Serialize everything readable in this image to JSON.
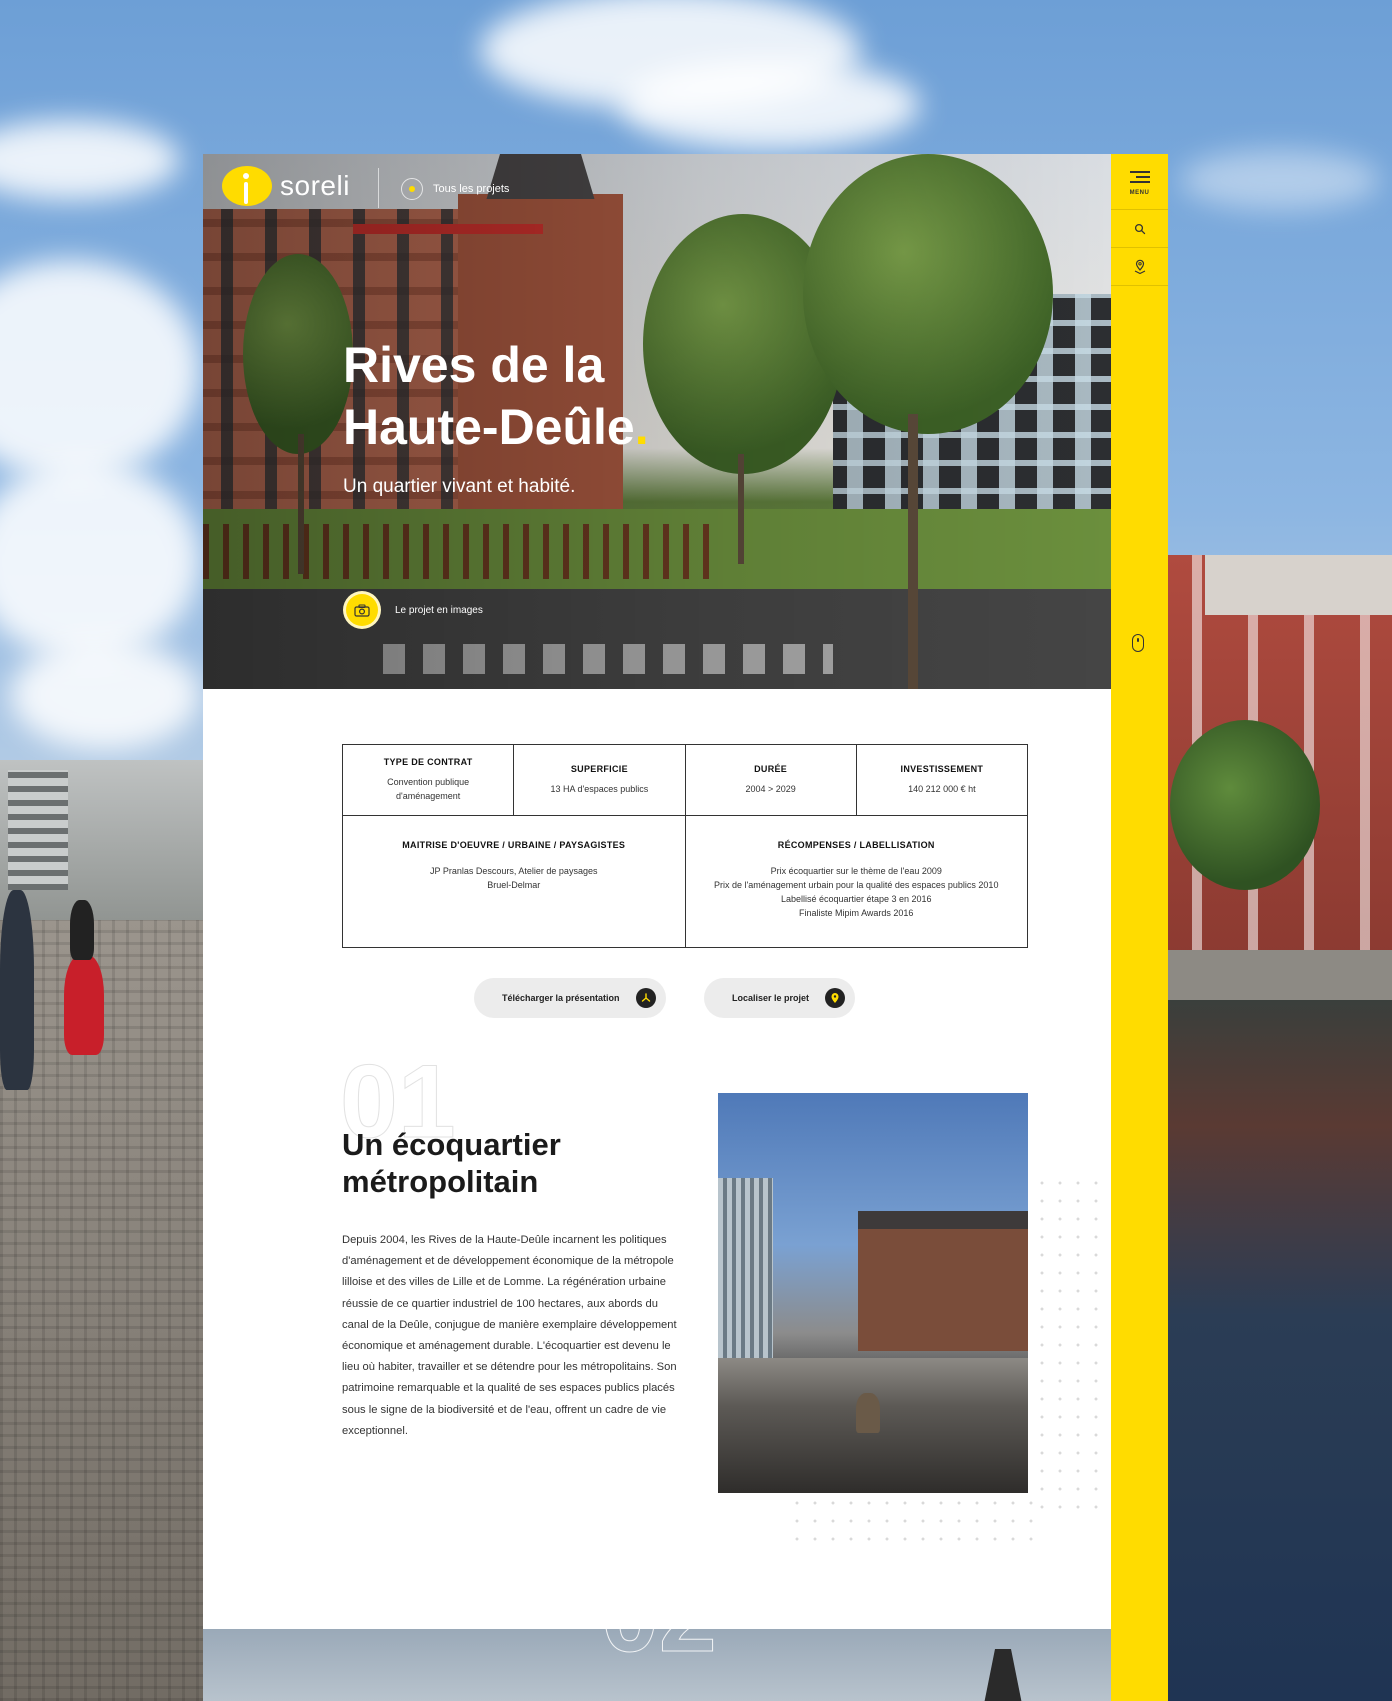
{
  "brand": {
    "name": "soreli",
    "accent": "#ffdc00"
  },
  "header": {
    "all_projects_label": "Tous les projets"
  },
  "hero": {
    "title_line1": "Rives de la",
    "title_line2": "Haute-Deûle",
    "title_dot": ".",
    "subtitle": "Un quartier vivant et habité.",
    "gallery_button": "Le projet en images"
  },
  "info": {
    "contract": {
      "label": "TYPE DE CONTRAT",
      "value": "Convention publique d'aménagement"
    },
    "area": {
      "label": "SUPERFICIE",
      "value": "13 HA d'espaces publics"
    },
    "duration": {
      "label": "DURÉE",
      "value": "2004 > 2029"
    },
    "investment": {
      "label": "INVESTISSEMENT",
      "value": "140 212 000 € ht"
    },
    "management": {
      "label": "MAITRISE D'OEUVRE / URBAINE / PAYSAGISTES",
      "value": "JP Pranlas Descours, Atelier de paysages Bruel-Delmar"
    },
    "awards": {
      "label": "RÉCOMPENSES / LABELLISATION",
      "items": [
        "Prix écoquartier sur le thème de l'eau 2009",
        "Prix de l'aménagement urbain pour la qualité des espaces publics 2010",
        "Labellisé écoquartier étape 3 en 2016",
        "Finaliste Mipim Awards 2016"
      ]
    }
  },
  "actions": {
    "download": "Télécharger la présentation",
    "locate": "Localiser le projet"
  },
  "section1": {
    "number": "01",
    "title_line1": "Un écoquartier",
    "title_line2": "métropolitain",
    "body": "Depuis 2004, les Rives de la Haute-Deûle incarnent les politiques d'aménagement et de développement économique de la métropole lilloise et des villes de Lille et de Lomme. La régénération urbaine réussie de ce quartier industriel de 100 hectares, aux abords du canal de la Deûle, conjugue de manière exemplaire développement économique et aménagement durable. L'écoquartier est devenu le lieu où habiter, travailler et se détendre pour les métropolitains. Son patrimoine remarquable et la qualité de ses espaces publics placés sous le signe de la biodiversité et de l'eau, offrent un cadre de vie exceptionnel."
  },
  "section2": {
    "number": "02"
  },
  "rail": {
    "menu_label": "MENU"
  },
  "icons": {
    "menu": "hamburger-icon",
    "search": "search-icon",
    "locate": "map-pin-icon",
    "scroll": "mouse-scroll-icon",
    "camera": "camera-icon",
    "download": "pdf-icon"
  }
}
